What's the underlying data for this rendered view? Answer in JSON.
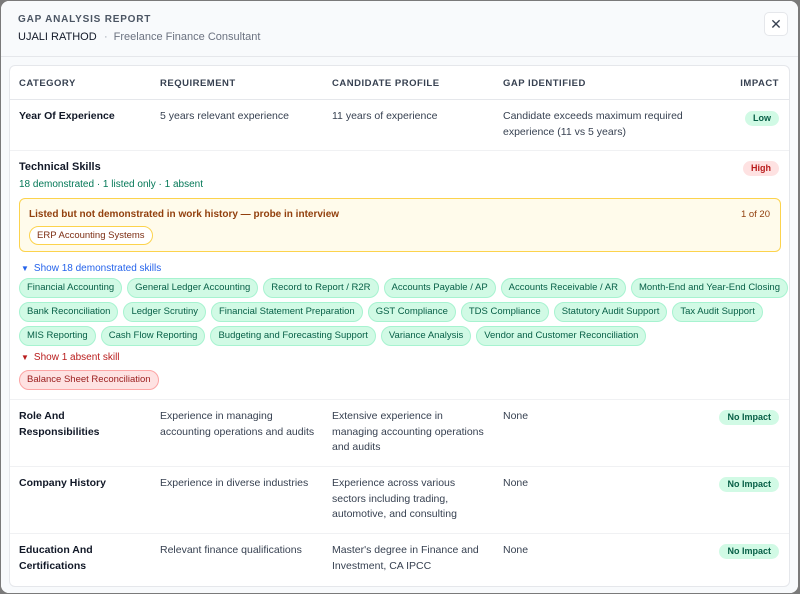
{
  "header": {
    "label": "GAP ANALYSIS REPORT",
    "name": "UJALI RATHOD",
    "role": "Freelance Finance Consultant",
    "close_icon": "close-icon"
  },
  "table": {
    "columns": [
      "CATEGORY",
      "REQUIREMENT",
      "CANDIDATE PROFILE",
      "GAP IDENTIFIED",
      "IMPACT"
    ]
  },
  "rows": {
    "experience": {
      "category": "Year Of Experience",
      "requirement": "5 years relevant experience",
      "profile": "11 years of experience",
      "gap": "Candidate exceeds maximum required experience (11 vs 5 years)",
      "impact": "Low"
    },
    "role": {
      "category": "Role And Responsibilities",
      "requirement": "Experience in managing accounting operations and audits",
      "profile": "Extensive experience in managing accounting operations and audits",
      "gap": "None",
      "impact": "No Impact"
    },
    "company": {
      "category": "Company History",
      "requirement": "Experience in diverse industries",
      "profile": "Experience across various sectors including trading, automotive, and consulting",
      "gap": "None",
      "impact": "No Impact"
    },
    "education": {
      "category": "Education And Certifications",
      "requirement": "Relevant finance qualifications",
      "profile": "Master's degree in Finance and Investment, CA IPCC",
      "gap": "None",
      "impact": "No Impact"
    }
  },
  "technical": {
    "title": "Technical Skills",
    "summary": "18 demonstrated · 1 listed only · 1 absent",
    "impact": "High",
    "warning_title": "Listed but not demonstrated in work history — probe in interview",
    "warning_count": "1 of 20",
    "listed_only": [
      "ERP Accounting Systems"
    ],
    "show_demonstrated": "Show 18 demonstrated skills",
    "demonstrated": [
      "Financial Accounting",
      "General Ledger Accounting",
      "Record to Report / R2R",
      "Accounts Payable / AP",
      "Accounts Receivable / AR",
      "Month-End and Year-End Closing",
      "Bank Reconciliation",
      "Ledger Scrutiny",
      "Financial Statement Preparation",
      "GST Compliance",
      "TDS Compliance",
      "Statutory Audit Support",
      "Tax Audit Support",
      "MIS Reporting",
      "Cash Flow Reporting",
      "Budgeting and Forecasting Support",
      "Variance Analysis",
      "Vendor and Customer Reconciliation"
    ],
    "show_absent": "Show 1 absent skill",
    "absent": [
      "Balance Sheet Reconciliation"
    ]
  },
  "colors": {
    "low_badge": "#d1fae5",
    "high_badge": "#fee2e2",
    "warning_bg": "#fffbeb",
    "link_blue": "#2563eb"
  }
}
